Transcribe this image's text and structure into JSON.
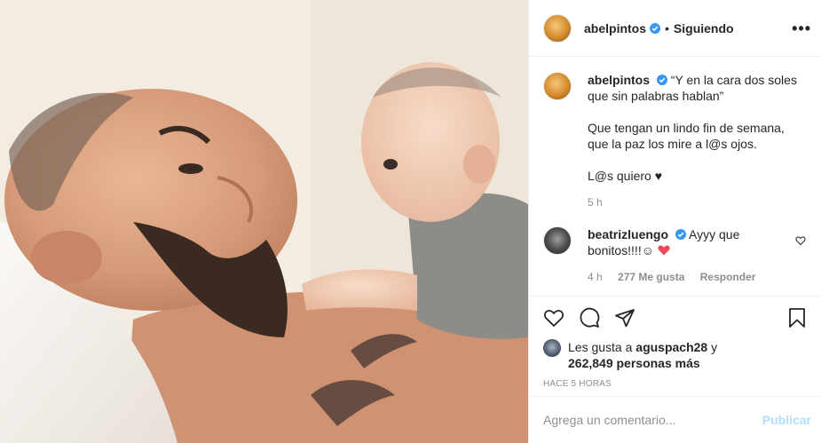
{
  "post": {
    "username": "abelpintos",
    "follow_status": "Siguiendo",
    "more": "•••",
    "caption_lines_1": [
      "“Y en la cara dos soles",
      "que sin palabras hablan”"
    ],
    "caption_lines_2": [
      "Que tengan un lindo fin de semana,",
      "que la paz los mire a l@s ojos."
    ],
    "caption_line_3": "L@s quiero ♥",
    "caption_time": "5 h"
  },
  "comment": {
    "username": "beatrizluengo",
    "text_1": "Ayyy que",
    "text_2": "bonitos!!!!☺",
    "time": "4 h",
    "likes": "277 Me gusta",
    "reply": "Responder"
  },
  "likes": {
    "prefix": "Les gusta a",
    "user": "aguspach28",
    "conj": "y",
    "count_text": "262,849 personas más"
  },
  "timestamp": "HACE 5 HORAS",
  "add_comment": {
    "placeholder": "Agrega un comentario...",
    "publish": "Publicar"
  },
  "colors": {
    "verified": "#3897f0",
    "publish_disabled": "#b2dffc",
    "heart_red": "#ed4956"
  }
}
